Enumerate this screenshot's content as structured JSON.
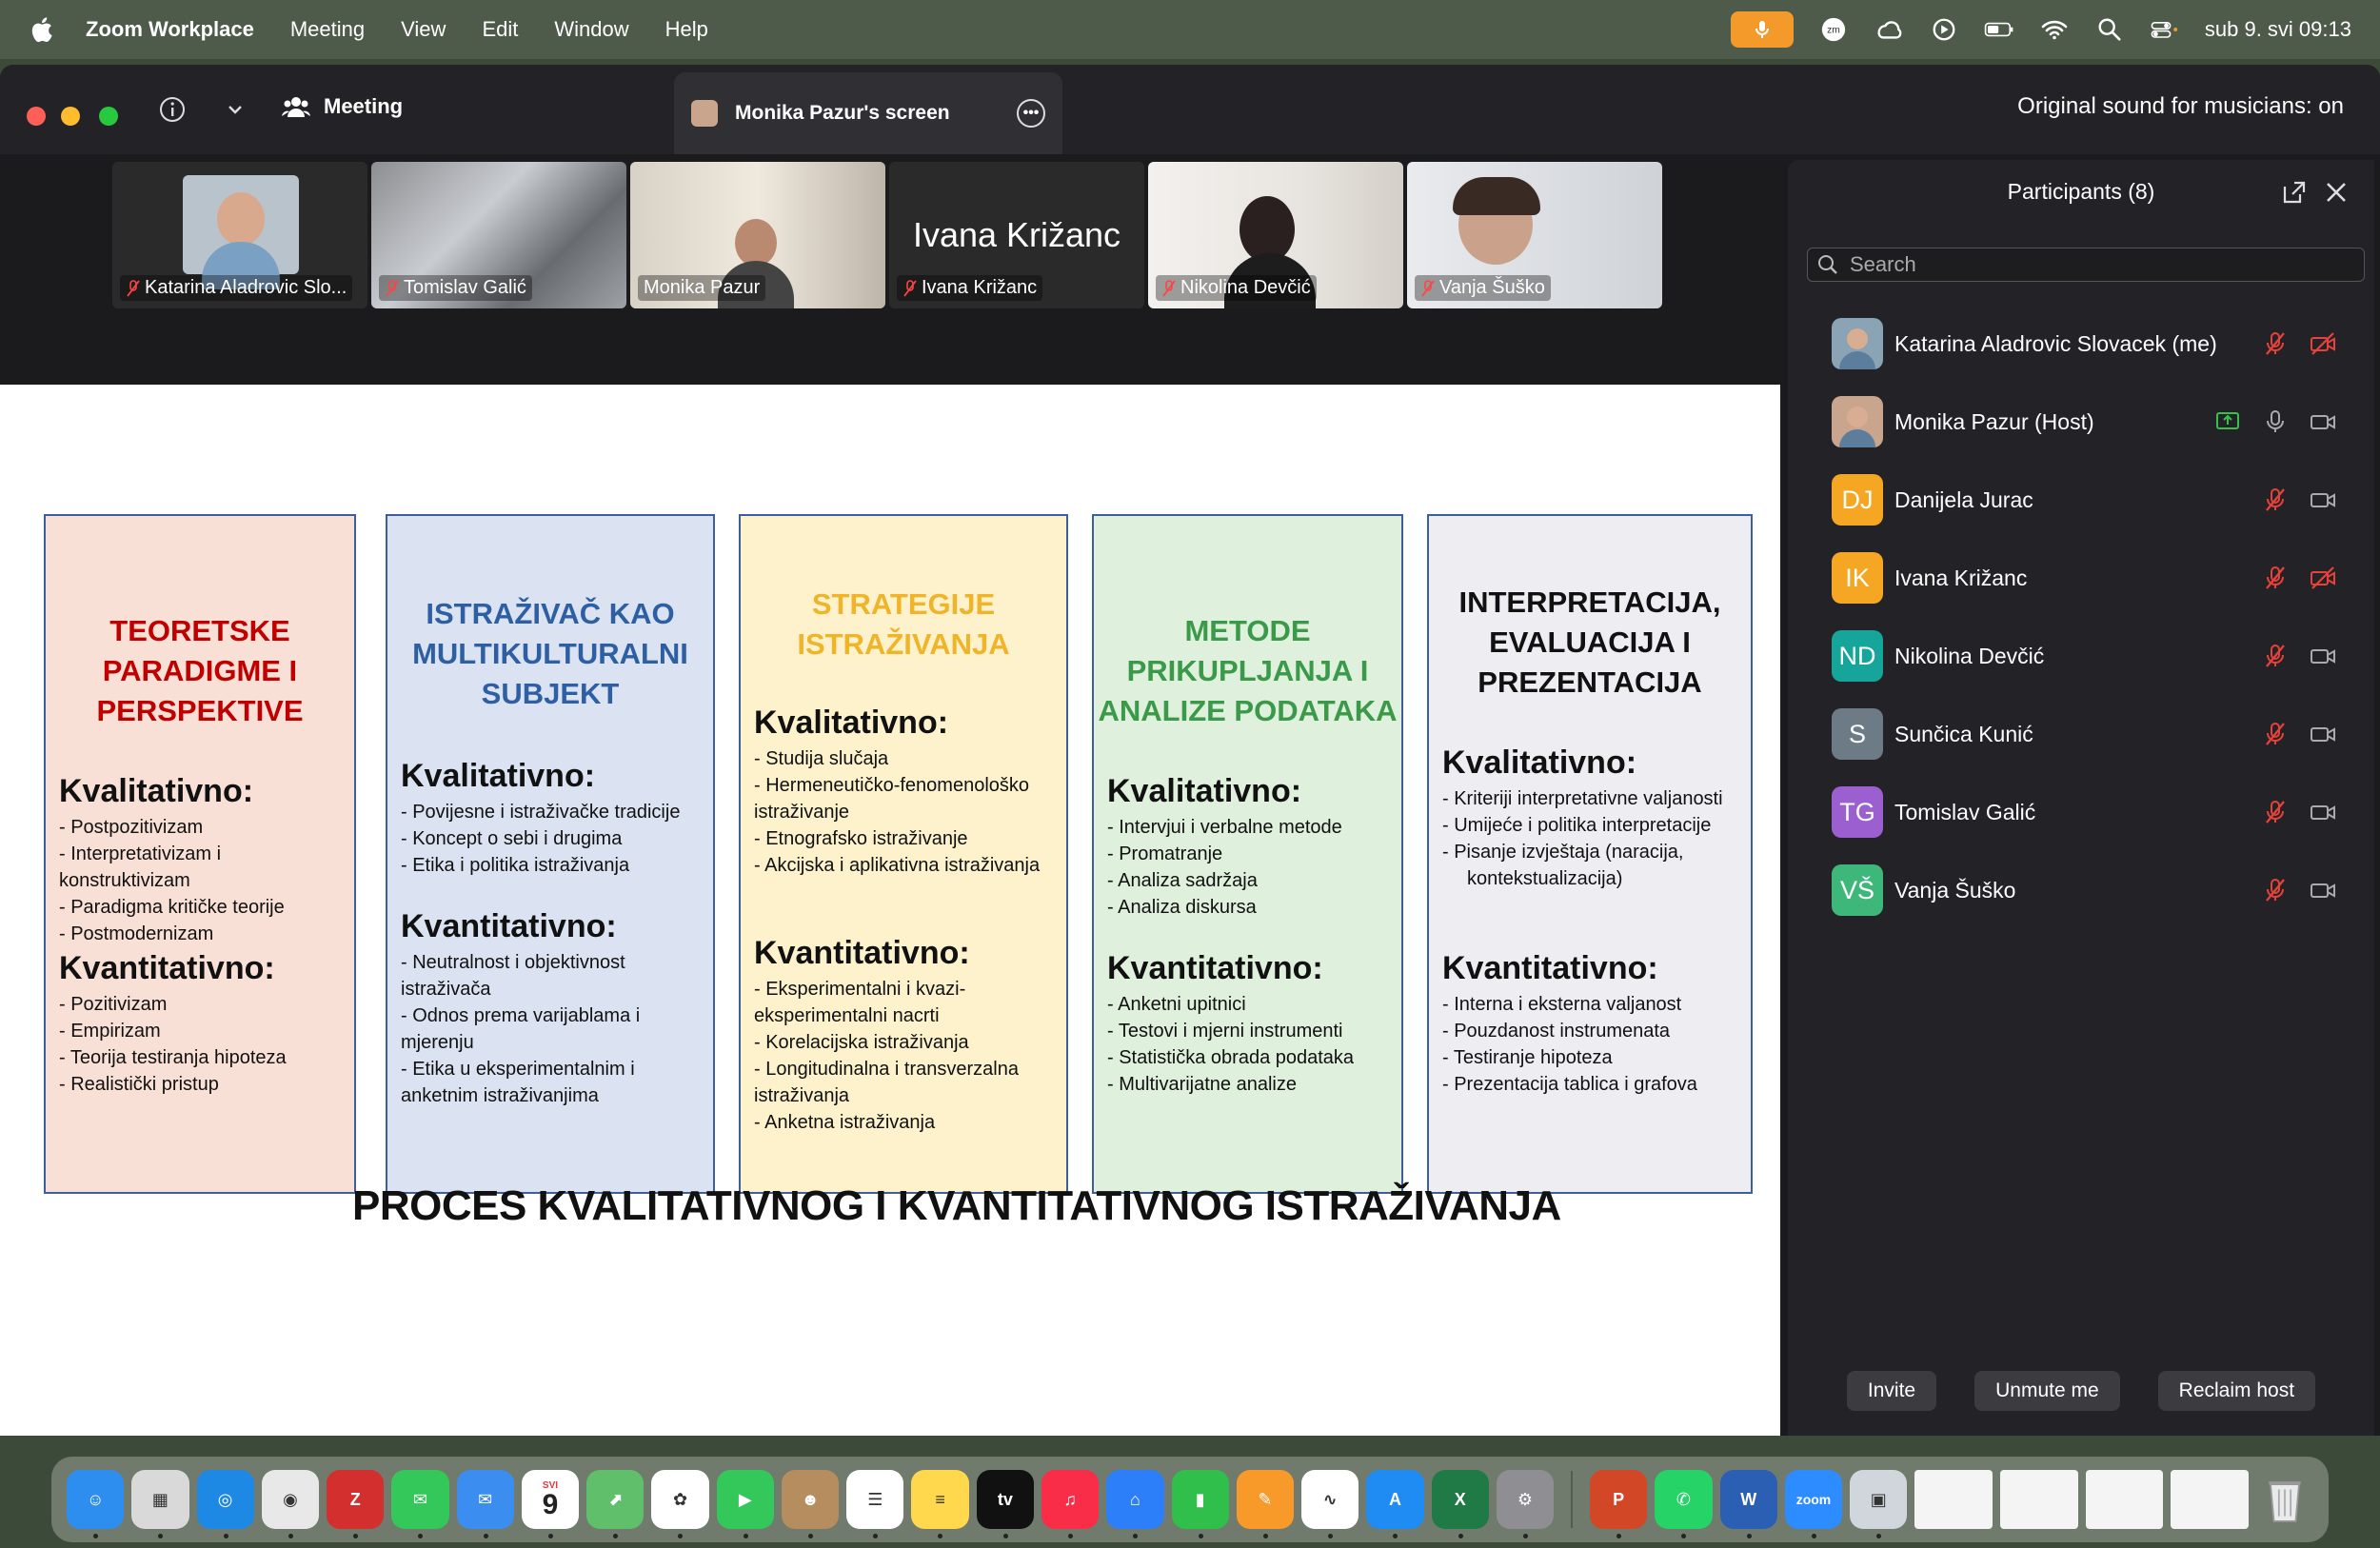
{
  "menubar": {
    "app": "Zoom Workplace",
    "items": [
      "Meeting",
      "View",
      "Edit",
      "Window",
      "Help"
    ],
    "clock": "sub 9. svi  09:13",
    "zm_badge": "zm"
  },
  "titlebar": {
    "meeting_label": "Meeting",
    "tab_label": "Monika Pazur's screen",
    "original_sound": "Original sound for musicians: on"
  },
  "tiles": [
    {
      "name": "Katarina Aladrovic Slo...",
      "type": "video"
    },
    {
      "name": "Tomislav Galić",
      "type": "video"
    },
    {
      "name": "Monika Pazur",
      "type": "video",
      "active": true
    },
    {
      "name": "Ivana Križanc",
      "type": "name",
      "big": "Ivana Križanc"
    },
    {
      "name": "Nikolina Devčić",
      "type": "video"
    },
    {
      "name": "Vanja Šuško",
      "type": "video"
    }
  ],
  "slide": {
    "title": "PROCES KVALITATIVNOG I KVANTITATIVNOG ISTRAŽIVANJA",
    "columns": [
      {
        "heading": [
          "TEORETSKE",
          "PARADIGME I",
          "PERSPEKTIVE"
        ],
        "color": "#c00000",
        "bg": "#f8e0d6",
        "qual_title": "Kvalitativno:",
        "qual": [
          "- Postpozitivizam",
          "- Interpretativizam i konstruktivizam",
          "- Paradigma kritičke teorije",
          "- Postmodernizam"
        ],
        "quant_title": "Kvantitativno:",
        "quant": [
          "- Pozitivizam",
          "- Empirizam",
          "- Teorija testiranja hipoteza",
          "- Realistički pristup"
        ]
      },
      {
        "heading": [
          "ISTRAŽIVAČ KAO",
          "MULTIKULTURALNI",
          "SUBJEKT"
        ],
        "color": "#2e5fa3",
        "bg": "#dbe3f3",
        "qual_title": "Kvalitativno:",
        "qual": [
          "- Povijesne i istraživačke tradicije",
          "- Koncept o sebi i drugima",
          "-   Etika i politika istraživanja"
        ],
        "quant_title": "Kvantitativno:",
        "quant": [
          "- Neutralnost i objektivnost istraživača",
          "- Odnos prema varijablama i mjerenju",
          "- Etika u eksperimentalnim i anketnim istraživanjima"
        ]
      },
      {
        "heading": [
          "STRATEGIJE",
          "ISTRAŽIVANJA"
        ],
        "color": "#f0b429",
        "bg": "#fdf2cc",
        "qual_title": "Kvalitativno:",
        "qual": [
          "- Studija slučaja",
          "- Hermeneutičko-fenomenološko istraživanje",
          "- Etnografsko istraživanje",
          "-   Akcijska i aplikativna istraživanja"
        ],
        "quant_title": "Kvantitativno:",
        "quant": [
          "- Eksperimentalni i kvazi-eksperimentalni nacrti",
          "- Korelacijska istraživanja",
          "- Longitudinalna i transverzalna istraživanja",
          "- Anketna istraživanja"
        ]
      },
      {
        "heading": [
          "METODE",
          "PRIKUPLJANJA I",
          "ANALIZE PODATAKA"
        ],
        "color": "#3a9a4a",
        "bg": "#dff0dc",
        "qual_title": "Kvalitativno:",
        "qual": [
          "- Intervjui i verbalne metode",
          "- Promatranje",
          "- Analiza sadržaja",
          "-   Analiza diskursa"
        ],
        "quant_title": "Kvantitativno:",
        "quant": [
          "- Anketni upitnici",
          "- Testovi i mjerni instrumenti",
          "- Statistička obrada podataka",
          "- Multivarijatne analize"
        ]
      },
      {
        "heading": [
          "INTERPRETACIJA,",
          "EVALUACIJA I",
          "PREZENTACIJA"
        ],
        "color": "#111111",
        "bg": "#eeeef2",
        "qual_title": "Kvalitativno:",
        "qual": [
          "- Kriteriji interpretativne valjanosti",
          "- Umijeće i politika interpretacije",
          "-   Pisanje izvještaja (naracija, kontekstualizacija)"
        ],
        "quant_title": "Kvantitativno:",
        "quant": [
          "- Interna i eksterna valjanost",
          "- Pouzdanost instrumenata",
          "- Testiranje hipoteza",
          "- Prezentacija tablica i grafova"
        ]
      }
    ]
  },
  "participants": {
    "title": "Participants (8)",
    "search_placeholder": "Search",
    "list": [
      {
        "name": "Katarina Aladrovic Slovacek (me)",
        "initials": "",
        "color": "#8aa3b5",
        "photo": true,
        "video_off": true
      },
      {
        "name": "Monika Pazur (Host)",
        "initials": "",
        "color": "#c9a58e",
        "photo": true,
        "sharing": true,
        "mic_on": true
      },
      {
        "name": "Danijela Jurac",
        "initials": "DJ",
        "color": "#f5a623"
      },
      {
        "name": "Ivana Križanc",
        "initials": "IK",
        "color": "#f5a623",
        "video_off": true
      },
      {
        "name": "Nikolina Devčić",
        "initials": "ND",
        "color": "#16a59a"
      },
      {
        "name": "Sunčica Kunić",
        "initials": "S",
        "color": "#6d7b87"
      },
      {
        "name": "Tomislav Galić",
        "initials": "TG",
        "color": "#9c5fd0"
      },
      {
        "name": "Vanja Šuško",
        "initials": "VŠ",
        "color": "#3db87a"
      }
    ],
    "buttons": [
      "Invite",
      "Unmute me",
      "Reclaim host"
    ]
  },
  "dock": {
    "apps": [
      {
        "n": "finder",
        "c": "#2e8ef0",
        "g": "☺"
      },
      {
        "n": "launchpad",
        "c": "#d9d9d9",
        "g": "▦"
      },
      {
        "n": "safari",
        "c": "#1e88e5",
        "g": "◎"
      },
      {
        "n": "chrome",
        "c": "#e8e8e8",
        "g": "◉"
      },
      {
        "n": "zotero",
        "c": "#d32f2f",
        "g": "Z"
      },
      {
        "n": "messages",
        "c": "#34c759",
        "g": "✉"
      },
      {
        "n": "mail",
        "c": "#3b8ef0",
        "g": "✉"
      },
      {
        "n": "calendar",
        "c": "#ffffff",
        "g": "9"
      },
      {
        "n": "maps",
        "c": "#5fbf6a",
        "g": "⬈"
      },
      {
        "n": "photos",
        "c": "#ffffff",
        "g": "✿"
      },
      {
        "n": "facetime",
        "c": "#34c759",
        "g": "▶"
      },
      {
        "n": "contacts",
        "c": "#b58d5f",
        "g": "☻"
      },
      {
        "n": "reminders",
        "c": "#ffffff",
        "g": "☰"
      },
      {
        "n": "notes",
        "c": "#ffd84d",
        "g": "≡"
      },
      {
        "n": "tv",
        "c": "#111111",
        "g": "tv"
      },
      {
        "n": "music",
        "c": "#fa2d48",
        "g": "♫"
      },
      {
        "n": "keynote",
        "c": "#2d7ff9",
        "g": "⌂"
      },
      {
        "n": "numbers",
        "c": "#2fbf4a",
        "g": "▮"
      },
      {
        "n": "pages",
        "c": "#f79a2a",
        "g": "✎"
      },
      {
        "n": "freeform",
        "c": "#ffffff",
        "g": "∿"
      },
      {
        "n": "app-store",
        "c": "#1e8cf2",
        "g": "A"
      },
      {
        "n": "excel",
        "c": "#1f7a45",
        "g": "X"
      },
      {
        "n": "system-settings",
        "c": "#8e8e93",
        "g": "⚙"
      },
      {
        "n": "powerpoint",
        "c": "#d24726",
        "g": "P"
      },
      {
        "n": "whatsapp",
        "c": "#25d366",
        "g": "✆"
      },
      {
        "n": "word",
        "c": "#2b5fb3",
        "g": "W"
      },
      {
        "n": "zoom",
        "c": "#2d8cff",
        "g": "zoom"
      },
      {
        "n": "preview",
        "c": "#d0d6dc",
        "g": "▣"
      }
    ],
    "calendar_month": "SVI",
    "calendar_day": "9"
  }
}
